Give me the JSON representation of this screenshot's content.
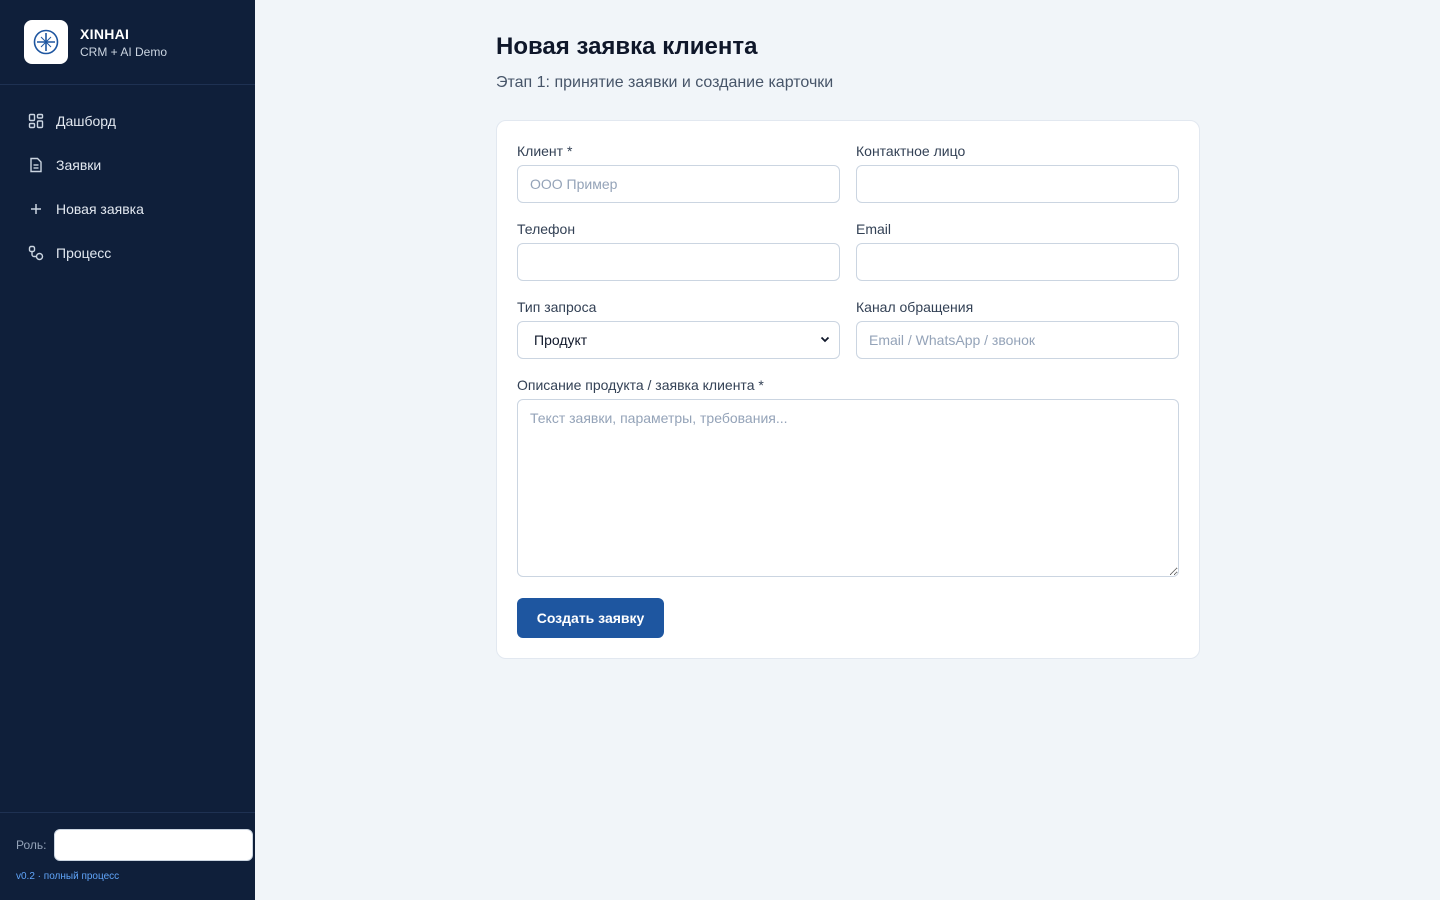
{
  "brand": {
    "name": "XINHAI",
    "subtitle": "CRM + AI Demo",
    "logo_icon": "compass-icon"
  },
  "sidebar": {
    "items": [
      {
        "label": "Дашборд",
        "icon": "dashboard-grid-icon"
      },
      {
        "label": "Заявки",
        "icon": "document-icon"
      },
      {
        "label": "Новая заявка",
        "icon": "plus-icon"
      },
      {
        "label": "Процесс",
        "icon": "workflow-icon"
      }
    ],
    "role_label": "Роль:",
    "role_value": "",
    "version": "v0.2 · полный процесс"
  },
  "page": {
    "title": "Новая заявка клиента",
    "subtitle": "Этап 1: принятие заявки и создание карточки"
  },
  "form": {
    "client": {
      "label": "Клиент *",
      "placeholder": "ООО Пример",
      "value": ""
    },
    "contact": {
      "label": "Контактное лицо",
      "placeholder": "",
      "value": ""
    },
    "phone": {
      "label": "Телефон",
      "placeholder": "",
      "value": ""
    },
    "email": {
      "label": "Email",
      "placeholder": "",
      "value": ""
    },
    "request_type": {
      "label": "Тип запроса",
      "selected": "Продукт"
    },
    "channel": {
      "label": "Канал обращения",
      "placeholder": "Email / WhatsApp / звонок",
      "value": ""
    },
    "description": {
      "label": "Описание продукта / заявка клиента *",
      "placeholder": "Текст заявки, параметры, требования..."
    },
    "submit_label": "Создать заявку"
  },
  "colors": {
    "sidebar_bg": "#0f1f3a",
    "accent": "#1e56a0",
    "page_bg": "#f1f5f9",
    "version_text": "#60a5fa"
  }
}
